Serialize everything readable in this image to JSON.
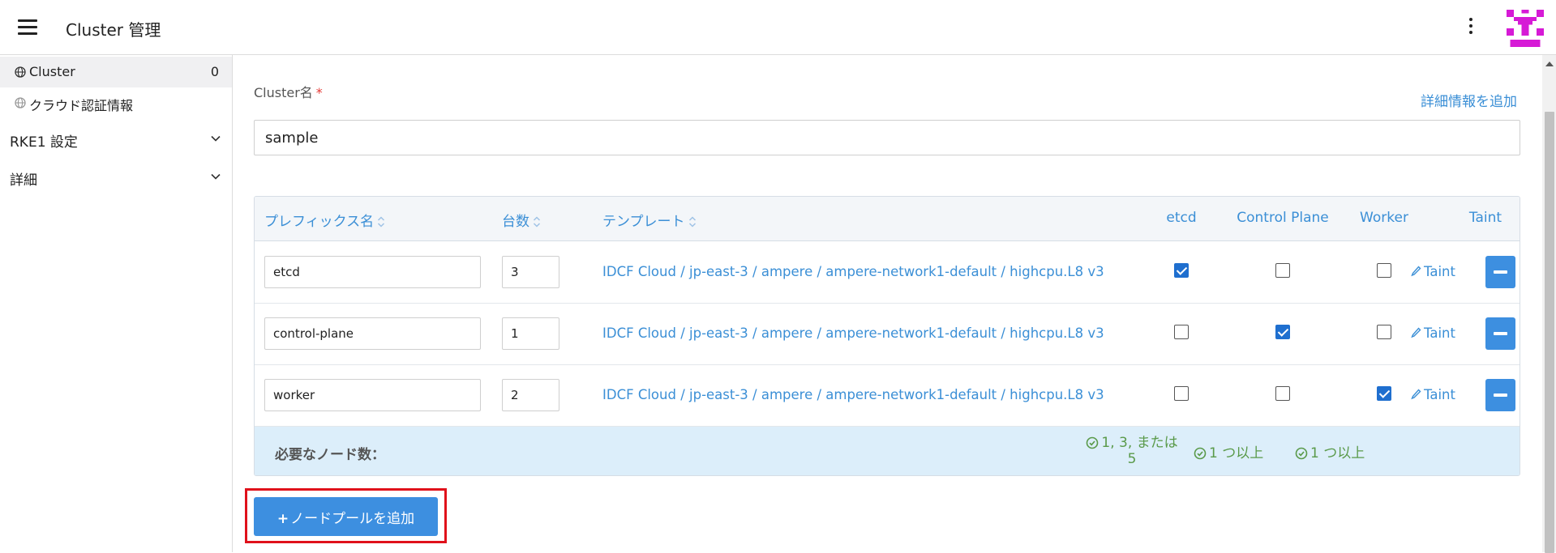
{
  "header": {
    "title": "Cluster 管理",
    "menu_icon": "hamburger-menu-icon",
    "more_icon": "kebab-menu-icon"
  },
  "sidebar": {
    "items": [
      {
        "label": "Cluster",
        "count": "0",
        "icon": "globe-icon",
        "active": true
      },
      {
        "label": "クラウド認証情報",
        "icon": "globe-icon",
        "active": false
      }
    ],
    "groups": [
      {
        "label": "RKE1 設定"
      },
      {
        "label": "詳細"
      }
    ]
  },
  "form": {
    "cluster_name_label": "Cluster名",
    "required_mark": "*",
    "add_detail_link": "詳細情報を追加",
    "cluster_name_value": "sample"
  },
  "node_pools": {
    "headers": {
      "prefix": "プレフィックス名",
      "count": "台数",
      "template": "テンプレート",
      "etcd": "etcd",
      "control_plane": "Control Plane",
      "worker": "Worker",
      "taint": "Taint"
    },
    "rows": [
      {
        "prefix": "etcd",
        "count": "3",
        "template": "IDCF Cloud / jp-east-3 / ampere / ampere-network1-default / highcpu.L8 v3",
        "etcd": true,
        "control_plane": false,
        "worker": false,
        "taint_label": "Taint"
      },
      {
        "prefix": "control-plane",
        "count": "1",
        "template": "IDCF Cloud / jp-east-3 / ampere / ampere-network1-default / highcpu.L8 v3",
        "etcd": false,
        "control_plane": true,
        "worker": false,
        "taint_label": "Taint"
      },
      {
        "prefix": "worker",
        "count": "2",
        "template": "IDCF Cloud / jp-east-3 / ampere / ampere-network1-default / highcpu.L8 v3",
        "etcd": false,
        "control_plane": false,
        "worker": true,
        "taint_label": "Taint"
      }
    ],
    "requirements": {
      "label": "必要なノード数：",
      "etcd_line1": "1, 3, または",
      "etcd_line2": "5",
      "control_plane": "1 つ以上",
      "worker": "1 つ以上"
    }
  },
  "add_pool_button": {
    "plus": "+",
    "label": "ノードプールを追加"
  },
  "colors": {
    "accent": "#3b8fd6",
    "button": "#3d8fe0",
    "highlight": "#e0111b",
    "ok_green": "#5a9a4a",
    "avatar": "#d61ad6"
  }
}
